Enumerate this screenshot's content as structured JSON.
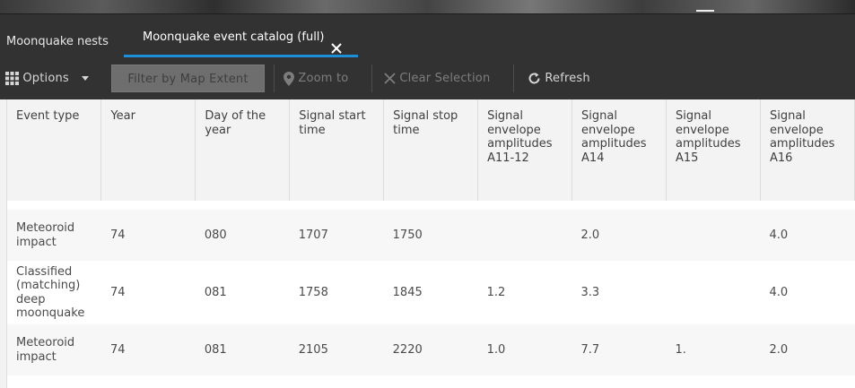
{
  "tabs": [
    {
      "label": "Moonquake nests"
    },
    {
      "label": "Moonquake event catalog (full)"
    }
  ],
  "toolbar": {
    "options_label": "Options",
    "filter_label": "Filter by Map Extent",
    "zoom_label": "Zoom to",
    "clear_label": "Clear Selection",
    "refresh_label": "Refresh"
  },
  "table": {
    "columns": [
      "Event type",
      "Year",
      "Day of the year",
      "Signal start time",
      "Signal stop time",
      "Signal envelope amplitudes A11-12",
      "Signal envelope amplitudes A14",
      "Signal envelope amplitudes A15",
      "Signal envelope amplitudes A16"
    ],
    "rows": [
      {
        "event_type": "Meteoroid impact",
        "year": "74",
        "day": "080",
        "start": "1707",
        "stop": "1750",
        "a11_12": "",
        "a14": "2.0",
        "a15": "",
        "a16": "4.0"
      },
      {
        "event_type": "Classified (matching) deep moonquake",
        "year": "74",
        "day": "081",
        "start": "1758",
        "stop": "1845",
        "a11_12": "1.2",
        "a14": "3.3",
        "a15": "",
        "a16": "4.0"
      },
      {
        "event_type": "Meteoroid impact",
        "year": "74",
        "day": "081",
        "start": "2105",
        "stop": "2220",
        "a11_12": "1.0",
        "a14": "7.7",
        "a15": "1.",
        "a16": "2.0"
      }
    ]
  },
  "colors": {
    "tab_accent": "#1e8ed8",
    "toolbar_bg": "#323232"
  },
  "icons": {
    "options": "grid-icon",
    "options_caret": "caret-down-icon",
    "zoom": "map-pin-icon",
    "clear": "close-icon",
    "refresh": "refresh-icon",
    "tab_close": "close-icon"
  }
}
